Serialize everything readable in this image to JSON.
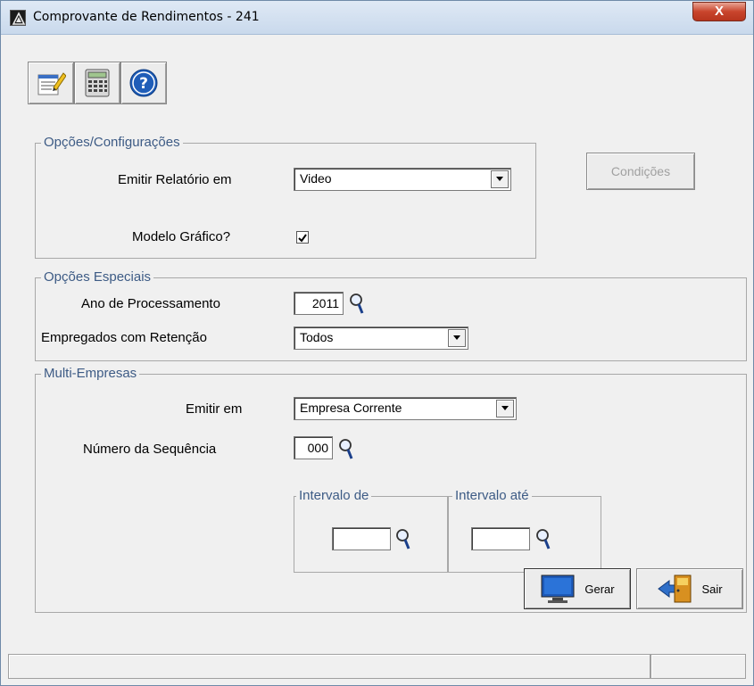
{
  "window": {
    "title": "Comprovante de Rendimentos - 241",
    "close_label": "X"
  },
  "toolbar": {
    "buttons": [
      {
        "icon": "notepad-edit-icon"
      },
      {
        "icon": "calculator-icon"
      },
      {
        "icon": "help-icon"
      }
    ]
  },
  "opcoes": {
    "legend": "Opções/Configurações",
    "emitir_label": "Emitir Relatório em",
    "emitir_value": "Video",
    "modelo_label": "Modelo Gráfico?",
    "modelo_checked": true
  },
  "condicoes_button": "Condições",
  "especiais": {
    "legend": "Opções Especiais",
    "ano_label": "Ano de Processamento",
    "ano_value": "2011",
    "empregados_label": "Empregados com Retenção",
    "empregados_value": "Todos"
  },
  "multi": {
    "legend": "Multi-Empresas",
    "emitir_label": "Emitir em",
    "emitir_value": "Empresa Corrente",
    "sequencia_label": "Número da Sequência",
    "sequencia_value": "000",
    "intervalo_de_legend": "Intervalo de",
    "intervalo_de_value": "",
    "intervalo_ate_legend": "Intervalo até",
    "intervalo_ate_value": ""
  },
  "actions": {
    "gerar_label": "Gerar",
    "sair_label": "Sair"
  },
  "colors": {
    "legend_text": "#3d5b85",
    "close_button": "#c9452d"
  }
}
